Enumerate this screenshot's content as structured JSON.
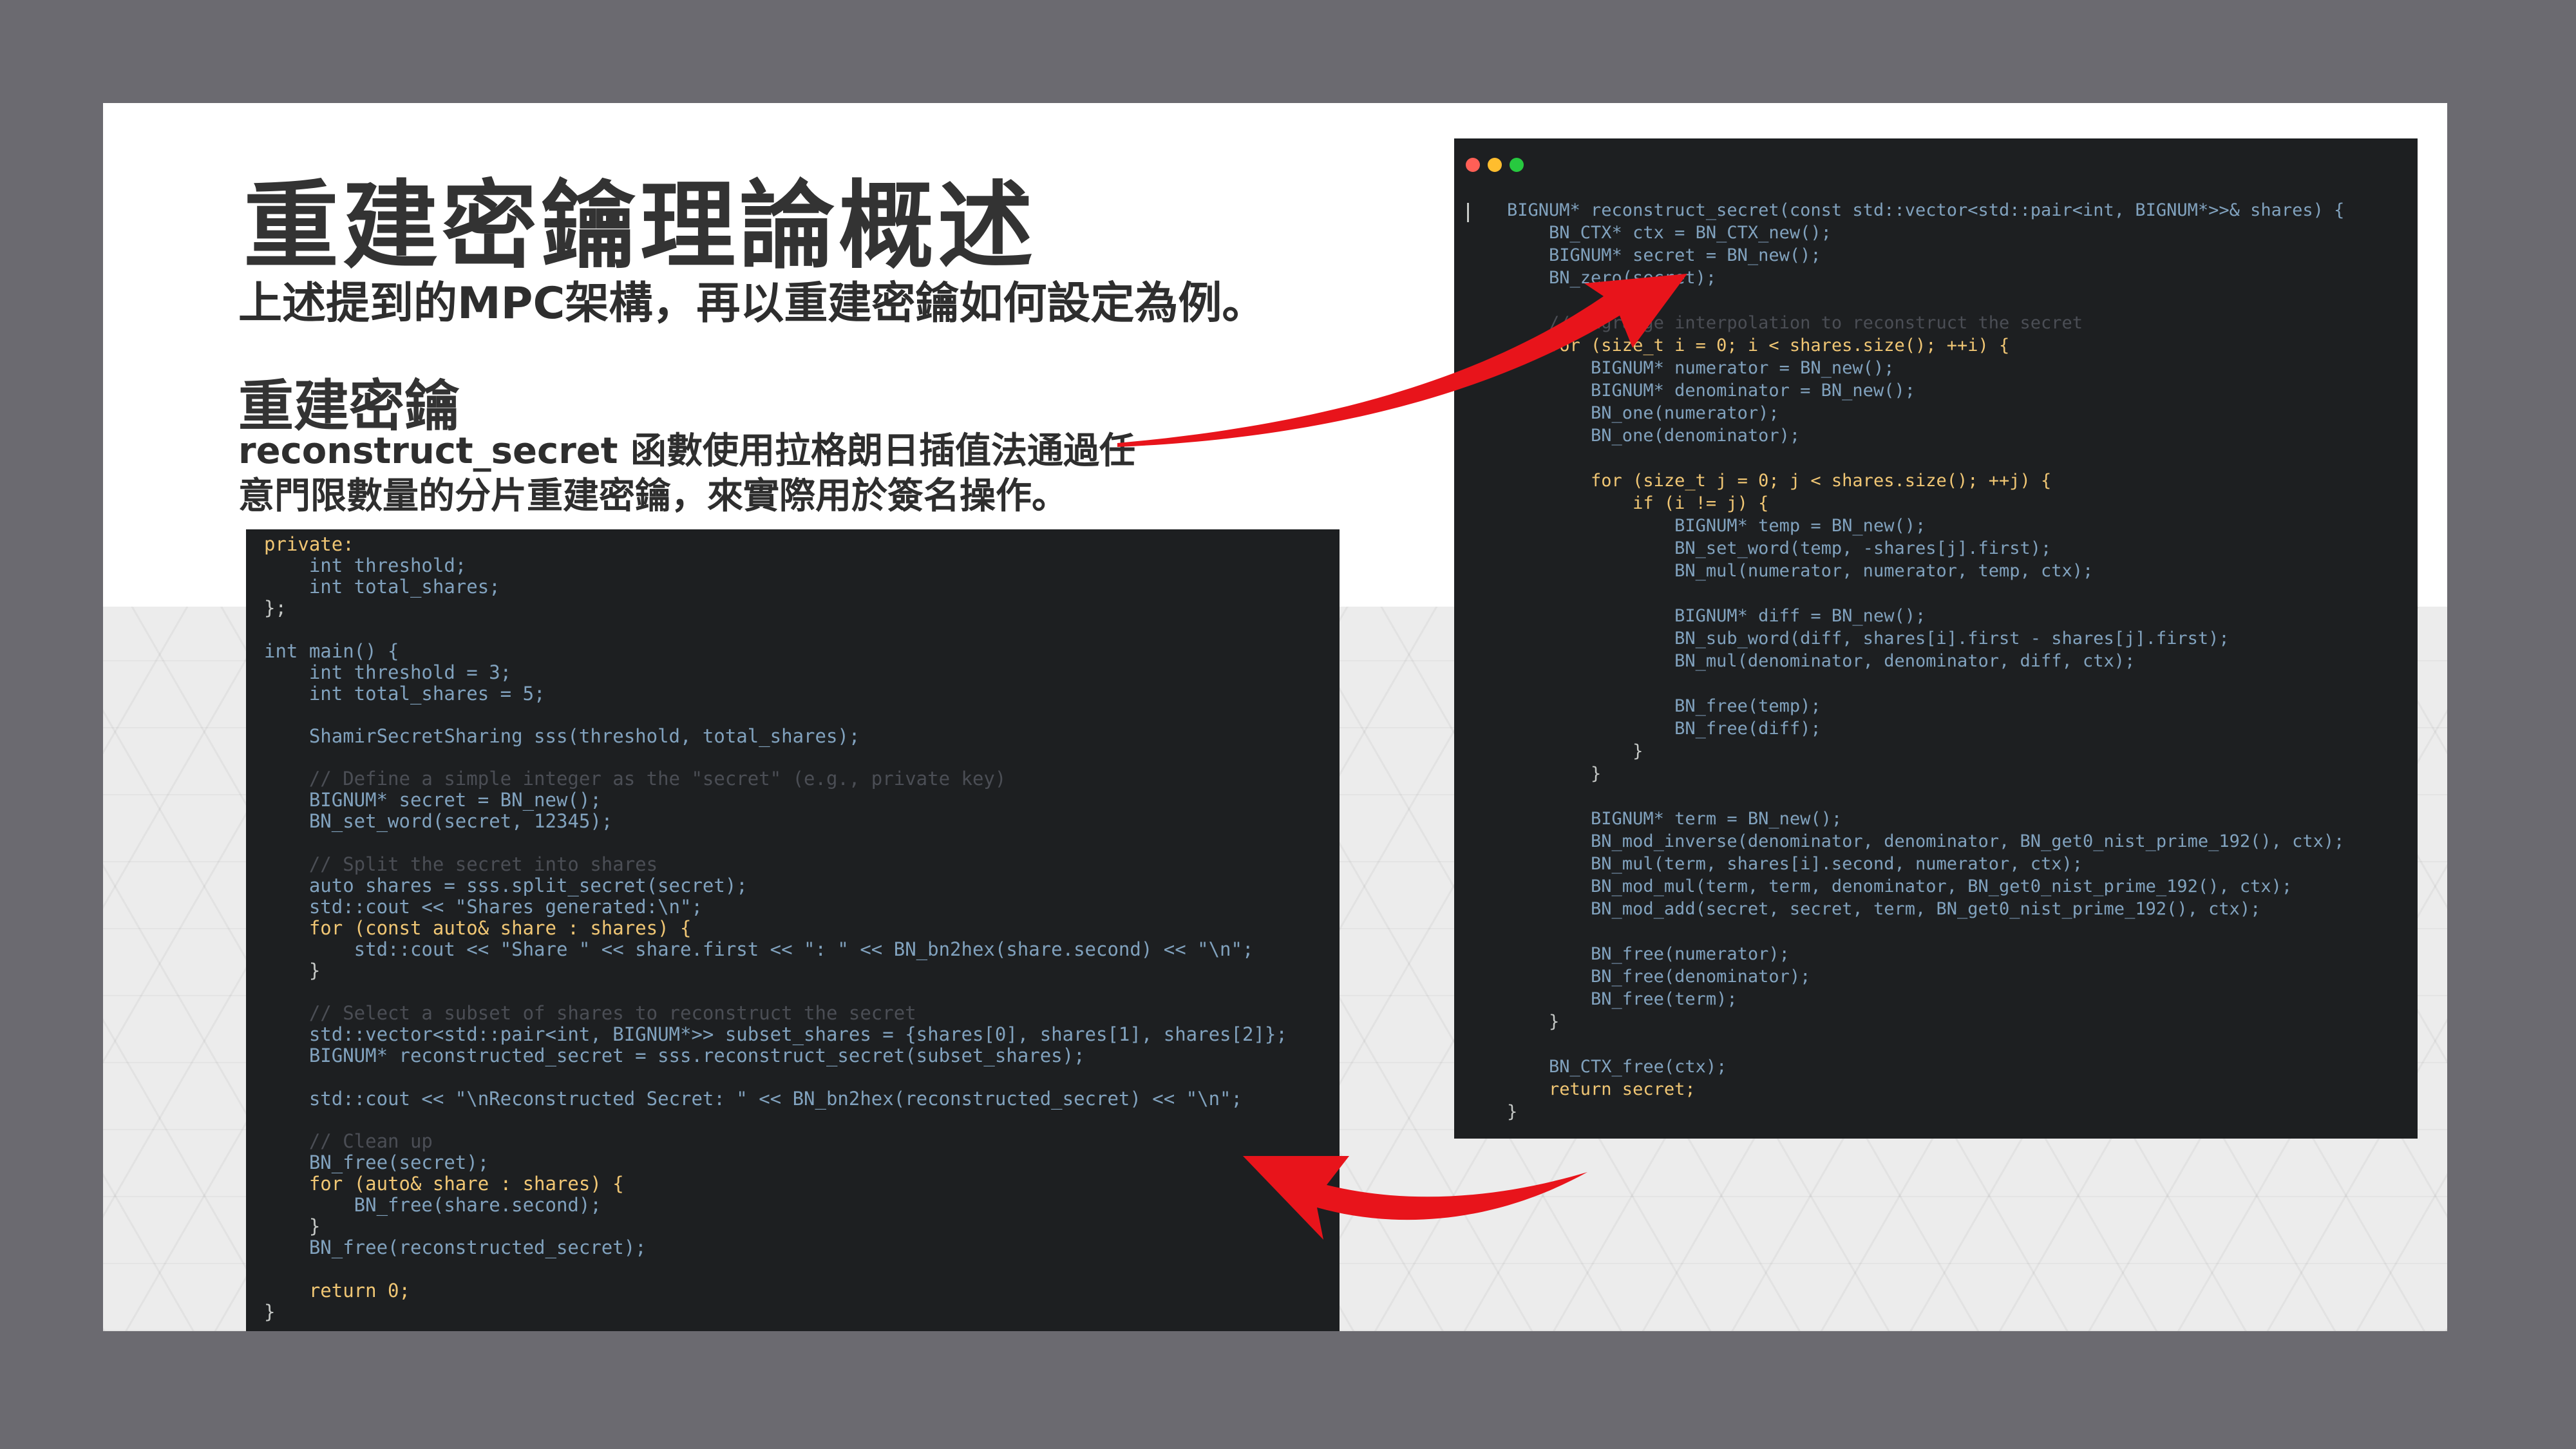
{
  "slide": {
    "title": "重建密鑰理論概述",
    "subtitle": "上述提到的MPC架構，再以重建密鑰如何設定為例。",
    "section_heading": "重建密鑰",
    "description_line1": "reconstruct_secret 函數使用拉格朗日插值法通過任",
    "description_line2": "意門限數量的分片重建密鑰，來實際用於簽名操作。"
  },
  "left_code": {
    "lines": [
      {
        "text": "private:",
        "color": "#f0c674"
      },
      {
        "text": "    int threshold;",
        "color": "#81a2be"
      },
      {
        "text": "    int total_shares;",
        "color": "#81a2be"
      },
      {
        "text": "};",
        "color": "#c5c8c6"
      },
      {
        "text": "",
        "color": "#c5c8c6"
      },
      {
        "text": "int main() {",
        "color": "#81a2be"
      },
      {
        "text": "    int threshold = 3;",
        "color": "#81a2be"
      },
      {
        "text": "    int total_shares = 5;",
        "color": "#81a2be"
      },
      {
        "text": "",
        "color": "#c5c8c6"
      },
      {
        "text": "    ShamirSecretSharing sss(threshold, total_shares);",
        "color": "#81a2be"
      },
      {
        "text": "",
        "color": "#c5c8c6"
      },
      {
        "text": "    // Define a simple integer as the \"secret\" (e.g., private key)",
        "color": "#4b4e55"
      },
      {
        "text": "    BIGNUM* secret = BN_new();",
        "color": "#81a2be"
      },
      {
        "text": "    BN_set_word(secret, 12345);",
        "color": "#81a2be"
      },
      {
        "text": "",
        "color": "#c5c8c6"
      },
      {
        "text": "    // Split the secret into shares",
        "color": "#4b4e55"
      },
      {
        "text": "    auto shares = sss.split_secret(secret);",
        "color": "#81a2be"
      },
      {
        "text": "    std::cout << \"Shares generated:\\n\";",
        "color": "#81a2be"
      },
      {
        "text": "    for (const auto& share : shares) {",
        "color": "#f0c674"
      },
      {
        "text": "        std::cout << \"Share \" << share.first << \": \" << BN_bn2hex(share.second) << \"\\n\";",
        "color": "#81a2be"
      },
      {
        "text": "    }",
        "color": "#c5c8c6"
      },
      {
        "text": "",
        "color": "#c5c8c6"
      },
      {
        "text": "    // Select a subset of shares to reconstruct the secret",
        "color": "#4b4e55"
      },
      {
        "text": "    std::vector<std::pair<int, BIGNUM*>> subset_shares = {shares[0], shares[1], shares[2]};",
        "color": "#81a2be"
      },
      {
        "text": "    BIGNUM* reconstructed_secret = sss.reconstruct_secret(subset_shares);",
        "color": "#81a2be"
      },
      {
        "text": "",
        "color": "#c5c8c6"
      },
      {
        "text": "    std::cout << \"\\nReconstructed Secret: \" << BN_bn2hex(reconstructed_secret) << \"\\n\";",
        "color": "#81a2be"
      },
      {
        "text": "",
        "color": "#c5c8c6"
      },
      {
        "text": "    // Clean up",
        "color": "#4b4e55"
      },
      {
        "text": "    BN_free(secret);",
        "color": "#81a2be"
      },
      {
        "text": "    for (auto& share : shares) {",
        "color": "#f0c674"
      },
      {
        "text": "        BN_free(share.second);",
        "color": "#81a2be"
      },
      {
        "text": "    }",
        "color": "#c5c8c6"
      },
      {
        "text": "    BN_free(reconstructed_secret);",
        "color": "#81a2be"
      },
      {
        "text": "",
        "color": "#c5c8c6"
      },
      {
        "text": "    return 0;",
        "color": "#f0c674"
      },
      {
        "text": "}",
        "color": "#c5c8c6"
      }
    ]
  },
  "right_code": {
    "lines": [
      {
        "text": "BIGNUM* reconstruct_secret(const std::vector<std::pair<int, BIGNUM*>>& shares) {",
        "color": "#81a2be"
      },
      {
        "text": "    BN_CTX* ctx = BN_CTX_new();",
        "color": "#81a2be"
      },
      {
        "text": "    BIGNUM* secret = BN_new();",
        "color": "#81a2be"
      },
      {
        "text": "    BN_zero(secret);",
        "color": "#81a2be"
      },
      {
        "text": "",
        "color": "#c5c8c6"
      },
      {
        "text": "    // Lagrange interpolation to reconstruct the secret",
        "color": "#4b4e55"
      },
      {
        "text": "    for (size_t i = 0; i < shares.size(); ++i) {",
        "color": "#f0c674"
      },
      {
        "text": "        BIGNUM* numerator = BN_new();",
        "color": "#81a2be"
      },
      {
        "text": "        BIGNUM* denominator = BN_new();",
        "color": "#81a2be"
      },
      {
        "text": "        BN_one(numerator);",
        "color": "#81a2be"
      },
      {
        "text": "        BN_one(denominator);",
        "color": "#81a2be"
      },
      {
        "text": "",
        "color": "#c5c8c6"
      },
      {
        "text": "        for (size_t j = 0; j < shares.size(); ++j) {",
        "color": "#f0c674"
      },
      {
        "text": "            if (i != j) {",
        "color": "#f0c674"
      },
      {
        "text": "                BIGNUM* temp = BN_new();",
        "color": "#81a2be"
      },
      {
        "text": "                BN_set_word(temp, -shares[j].first);",
        "color": "#81a2be"
      },
      {
        "text": "                BN_mul(numerator, numerator, temp, ctx);",
        "color": "#81a2be"
      },
      {
        "text": "",
        "color": "#c5c8c6"
      },
      {
        "text": "                BIGNUM* diff = BN_new();",
        "color": "#81a2be"
      },
      {
        "text": "                BN_sub_word(diff, shares[i].first - shares[j].first);",
        "color": "#81a2be"
      },
      {
        "text": "                BN_mul(denominator, denominator, diff, ctx);",
        "color": "#81a2be"
      },
      {
        "text": "",
        "color": "#c5c8c6"
      },
      {
        "text": "                BN_free(temp);",
        "color": "#81a2be"
      },
      {
        "text": "                BN_free(diff);",
        "color": "#81a2be"
      },
      {
        "text": "            }",
        "color": "#c5c8c6"
      },
      {
        "text": "        }",
        "color": "#c5c8c6"
      },
      {
        "text": "",
        "color": "#c5c8c6"
      },
      {
        "text": "        BIGNUM* term = BN_new();",
        "color": "#81a2be"
      },
      {
        "text": "        BN_mod_inverse(denominator, denominator, BN_get0_nist_prime_192(), ctx);",
        "color": "#81a2be"
      },
      {
        "text": "        BN_mul(term, shares[i].second, numerator, ctx);",
        "color": "#81a2be"
      },
      {
        "text": "        BN_mod_mul(term, term, denominator, BN_get0_nist_prime_192(), ctx);",
        "color": "#81a2be"
      },
      {
        "text": "        BN_mod_add(secret, secret, term, BN_get0_nist_prime_192(), ctx);",
        "color": "#81a2be"
      },
      {
        "text": "",
        "color": "#c5c8c6"
      },
      {
        "text": "        BN_free(numerator);",
        "color": "#81a2be"
      },
      {
        "text": "        BN_free(denominator);",
        "color": "#81a2be"
      },
      {
        "text": "        BN_free(term);",
        "color": "#81a2be"
      },
      {
        "text": "    }",
        "color": "#c5c8c6"
      },
      {
        "text": "",
        "color": "#c5c8c6"
      },
      {
        "text": "    BN_CTX_free(ctx);",
        "color": "#81a2be"
      },
      {
        "text": "    return secret;",
        "color": "#f0c674"
      },
      {
        "text": "}",
        "color": "#c5c8c6"
      }
    ]
  },
  "arrows": {
    "color": "#e8141b"
  }
}
